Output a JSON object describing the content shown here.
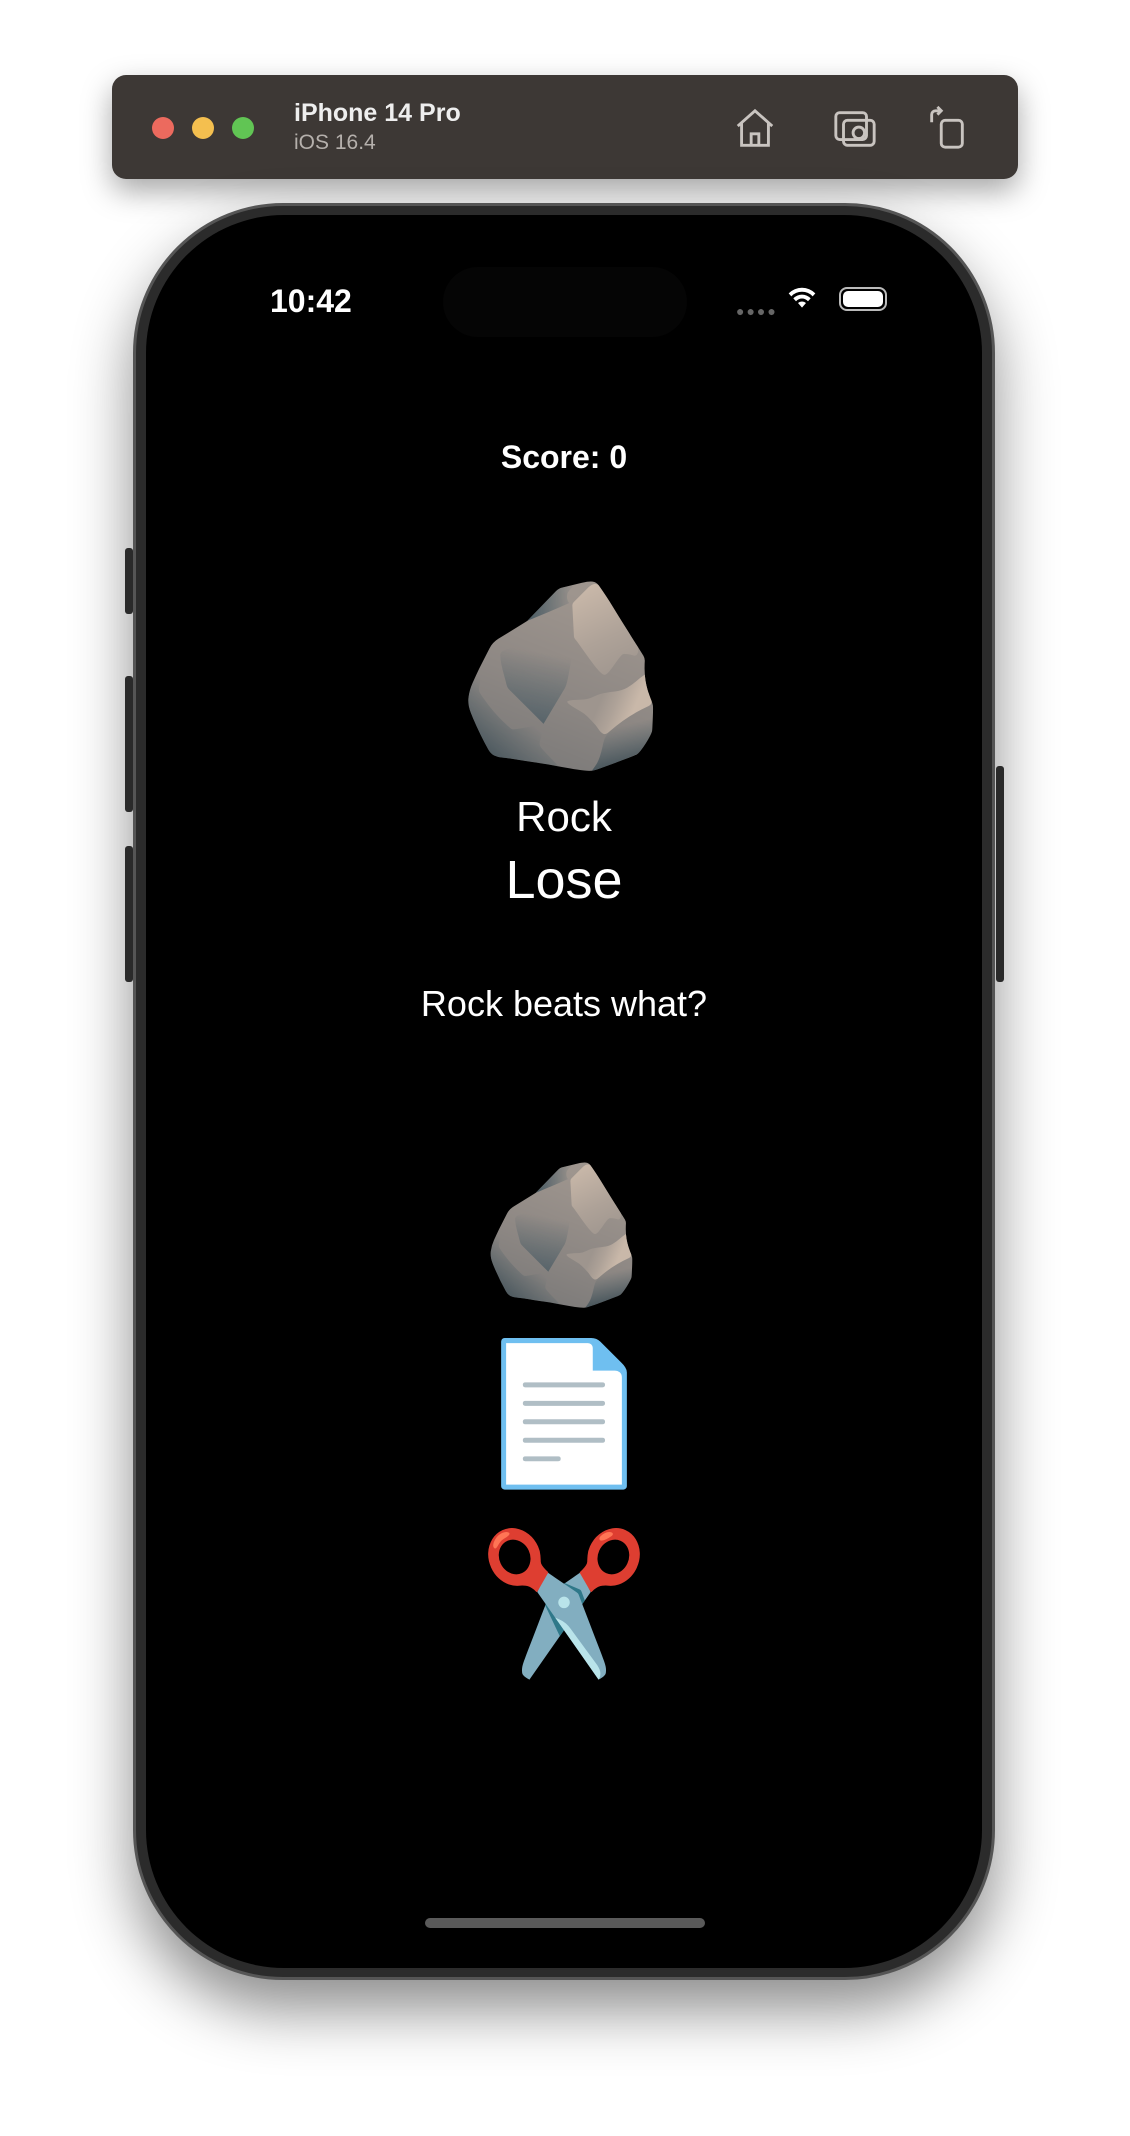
{
  "simulator": {
    "device": "iPhone 14 Pro",
    "os": "iOS 16.4",
    "controls": [
      "home-icon",
      "screenshot-icon",
      "rotate-icon"
    ]
  },
  "status_bar": {
    "time": "10:42"
  },
  "game": {
    "score": "Score: 0",
    "app_choice_emoji": "🪨",
    "app_choice_label": "Rock",
    "goal": "Lose",
    "prompt": "Rock beats what?",
    "options": [
      {
        "name": "rock",
        "emoji": "🪨"
      },
      {
        "name": "paper",
        "emoji": "📄"
      },
      {
        "name": "scissors",
        "emoji": "✂️"
      }
    ]
  }
}
